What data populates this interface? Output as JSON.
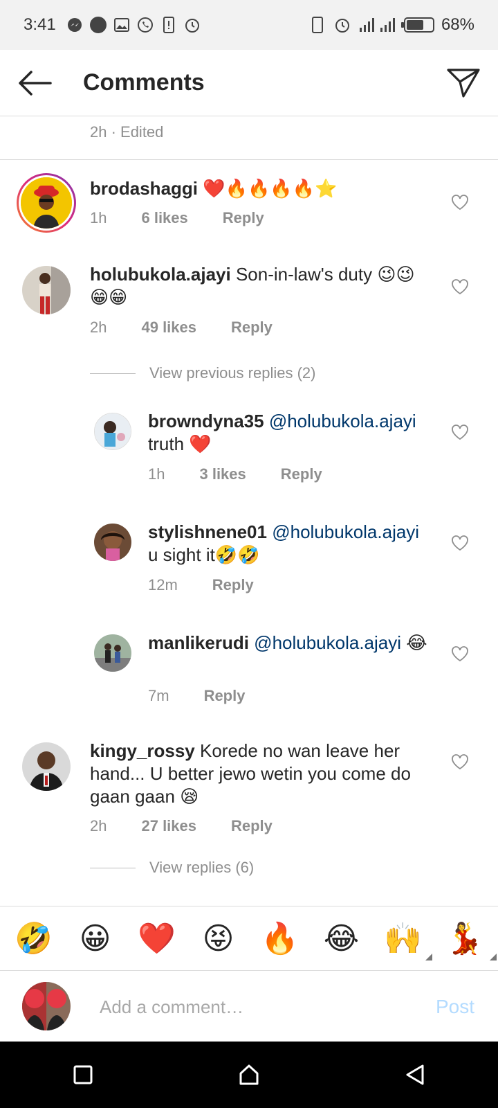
{
  "status_bar": {
    "time": "3:41",
    "battery": "68%",
    "battery_level": 0.68
  },
  "header": {
    "title": "Comments"
  },
  "top_meta": "2h · Edited",
  "comments": [
    {
      "username": "brodashaggi",
      "text": "❤️🔥🔥🔥🔥⭐",
      "mention": "",
      "time": "1h",
      "likes": "6 likes",
      "reply": "Reply"
    },
    {
      "username": "holubukola.ajayi",
      "text": "Son-in-law's duty 😉😉😁😁",
      "mention": "",
      "time": "2h",
      "likes": "49 likes",
      "reply": "Reply"
    },
    {
      "username": "browndyna35",
      "mention": "@holubukola.ajayi",
      "text": "truth ❤️",
      "time": "1h",
      "likes": "3 likes",
      "reply": "Reply"
    },
    {
      "username": "stylishnene01",
      "mention": "@holubukola.ajayi",
      "text": "u sight it🤣🤣",
      "time": "12m",
      "likes": "",
      "reply": "Reply"
    },
    {
      "username": "manlikerudi",
      "mention": "@holubukola.ajayi",
      "text": "😂",
      "time": "7m",
      "likes": "",
      "reply": "Reply"
    },
    {
      "username": "kingy_rossy",
      "text": "Korede no wan leave her hand... U better jewo wetin you come do gaan gaan 😪",
      "mention": "",
      "time": "2h",
      "likes": "27 likes",
      "reply": "Reply"
    }
  ],
  "view_previous_replies": "View previous replies (2)",
  "view_replies": "View replies (6)",
  "emoji_bar": [
    "🤣",
    "😀",
    "❤️",
    "😝",
    "🔥",
    "😂",
    "🙌",
    "💃"
  ],
  "input": {
    "placeholder": "Add a comment…",
    "post_label": "Post"
  },
  "colors": {
    "mention": "#00376b",
    "meta": "#8e8e8e",
    "post_disabled": "#b3dbff",
    "story_ring_start": "#c13584",
    "story_ring_end": "#f58529"
  }
}
